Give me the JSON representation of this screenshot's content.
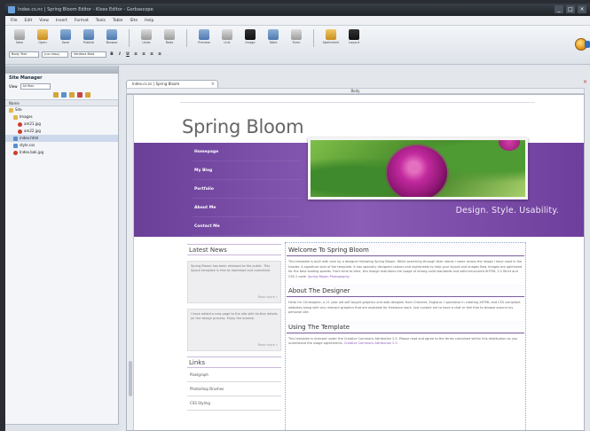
{
  "window": {
    "title": "Index.cs.nc | Spring Bloom Editor - Kloxo Editor - Gorbascope",
    "controls": [
      "_",
      "□",
      "×"
    ]
  },
  "menu": [
    "File",
    "Edit",
    "View",
    "Insert",
    "Format",
    "Tools",
    "Table",
    "Site",
    "Help"
  ],
  "toolbar": {
    "tools": [
      {
        "label": "New",
        "icon": "new-icon"
      },
      {
        "label": "Open",
        "icon": "open-icon"
      },
      {
        "label": "Save",
        "icon": "save-icon"
      },
      {
        "label": "Publish",
        "icon": "publish-icon"
      },
      {
        "label": "Browse",
        "icon": "browse-icon"
      },
      {
        "label": "Undo",
        "icon": "undo-icon"
      },
      {
        "label": "Redo",
        "icon": "redo-icon"
      },
      {
        "label": "Preview",
        "icon": "preview-icon"
      },
      {
        "label": "Link",
        "icon": "link-icon"
      },
      {
        "label": "Image",
        "icon": "image-icon"
      },
      {
        "label": "Table",
        "icon": "table-icon"
      },
      {
        "label": "Form",
        "icon": "form-icon"
      },
      {
        "label": "Spellcheck",
        "icon": "spellcheck-icon"
      },
      {
        "label": "Layout",
        "icon": "layout-icon"
      }
    ],
    "paragraph_style": "Body Text",
    "font_size_mode": "(no class)",
    "font_family": "Verdana Bold",
    "format_buttons": [
      "B",
      "I",
      "U",
      "≡",
      "≡",
      "≡",
      "≡"
    ]
  },
  "site_manager": {
    "header": "",
    "title": "Site Manager",
    "view_label": "View",
    "view_value": "All files",
    "names_header": "Name",
    "tree": [
      {
        "label": "Site",
        "icon": "folder",
        "indent": 0
      },
      {
        "label": "Images",
        "icon": "folder",
        "indent": 1
      },
      {
        "label": "am21.jpg",
        "icon": "red",
        "indent": 2
      },
      {
        "label": "am22.jpg",
        "icon": "red",
        "indent": 2
      },
      {
        "label": "index.html",
        "icon": "blue",
        "indent": 1
      },
      {
        "label": "style.css",
        "icon": "blue",
        "indent": 1
      },
      {
        "label": "Index.bak.jpg",
        "icon": "red",
        "indent": 1
      }
    ]
  },
  "document": {
    "tab_label": "Index.cs.nc | Spring Bloom",
    "ruler_label": "Body"
  },
  "page": {
    "site_title": "Spring Bloom",
    "nav": [
      "Homepage",
      "My Blog",
      "Portfolio",
      "About Me",
      "Contact Me"
    ],
    "tagline": "Design. Style. Usability.",
    "latest_news_heading": "Latest News",
    "news_items": [
      {
        "text": "Spring Bloom has been released to the public. This layout template is free to download and customize.",
        "more": "Read more »"
      },
      {
        "text": "I have added a new page to the site with further details on the design process. Enjoy the browse.",
        "more": "Read more »"
      }
    ],
    "links_heading": "Links",
    "links": [
      "Pixelgraph",
      "Photoshop Brushes",
      "CSS Styling"
    ],
    "welcome_heading": "Welcome To Spring Bloom",
    "welcome_text": "This template is built with care by a designer following Spring Bloom. While searching through their stores I came across the image I have used in the header. A signature shot of the template. It has specially designed colours and stylesheets to help your layout and images flow. Images are optimized for the best loading speeds. From time to time, this design maintains the usage of strong valid standards and valid structured XHTML 1.0 Strict and CSS 2 code.",
    "welcome_link": "Spring Bloom Photography",
    "designer_heading": "About The Designer",
    "designer_text": "Hello I'm Christopher, a 21 year old self taught graphics and web designer from Cheshire, England. I specialise in creating XHTML and CSS compliant websites along with any relevant graphics that are available for freelance work. Just contact me to have a chat or feel free to browse around my personal site.",
    "template_heading": "Using The Template",
    "template_text": "This template is licensed under the Creative Commons Attribution 2.5. Please read and agree to the terms contained within this distribution as you understand the usage agreements.",
    "template_link": "Creative Commons Attribution 2.5"
  }
}
